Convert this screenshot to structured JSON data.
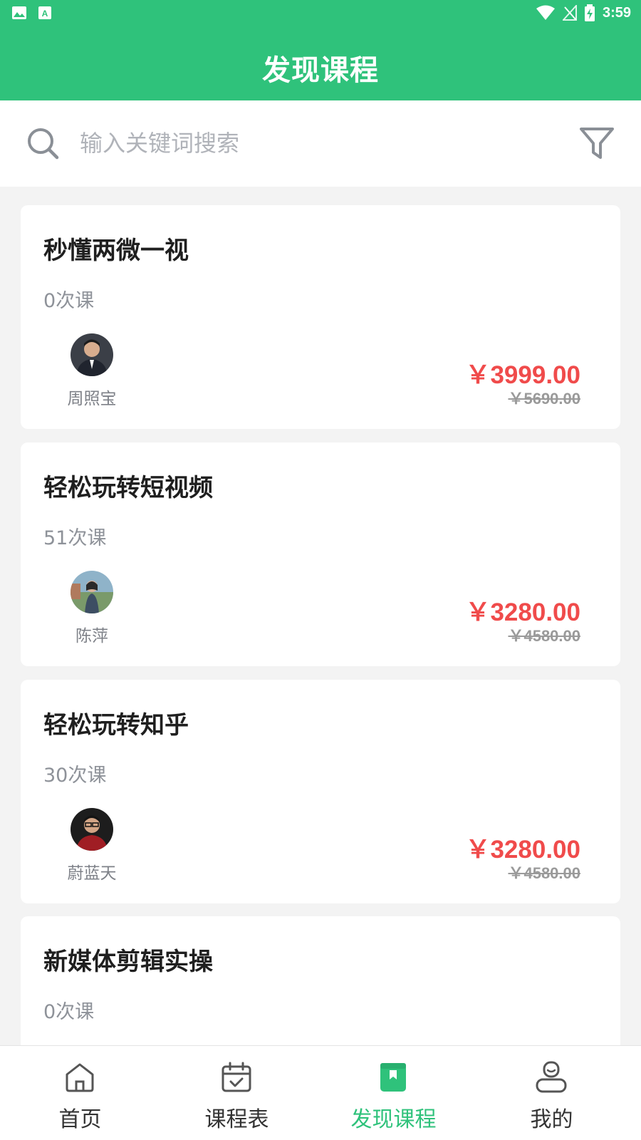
{
  "status_bar": {
    "time": "3:59"
  },
  "app_title": "发现课程",
  "search": {
    "placeholder": "输入关键词搜索"
  },
  "courses": [
    {
      "title": "秒懂两微一视",
      "count": "0次课",
      "teacher": "周照宝",
      "price": "￥3999.00",
      "original_price": "￥5690.00"
    },
    {
      "title": "轻松玩转短视频",
      "count": "51次课",
      "teacher": "陈萍",
      "price": "￥3280.00",
      "original_price": "￥4580.00"
    },
    {
      "title": "轻松玩转知乎",
      "count": "30次课",
      "teacher": "蔚蓝天",
      "price": "￥3280.00",
      "original_price": "￥4580.00"
    },
    {
      "title": "新媒体剪辑实操",
      "count": "0次课"
    }
  ],
  "tabs": [
    {
      "label": "首页",
      "icon": "home-icon"
    },
    {
      "label": "课程表",
      "icon": "calendar-icon"
    },
    {
      "label": "发现课程",
      "icon": "book-icon",
      "active": true
    },
    {
      "label": "我的",
      "icon": "user-icon"
    }
  ],
  "colors": {
    "brand": "#2fc27b",
    "price": "#f04b4b",
    "muted": "#8e9299"
  }
}
